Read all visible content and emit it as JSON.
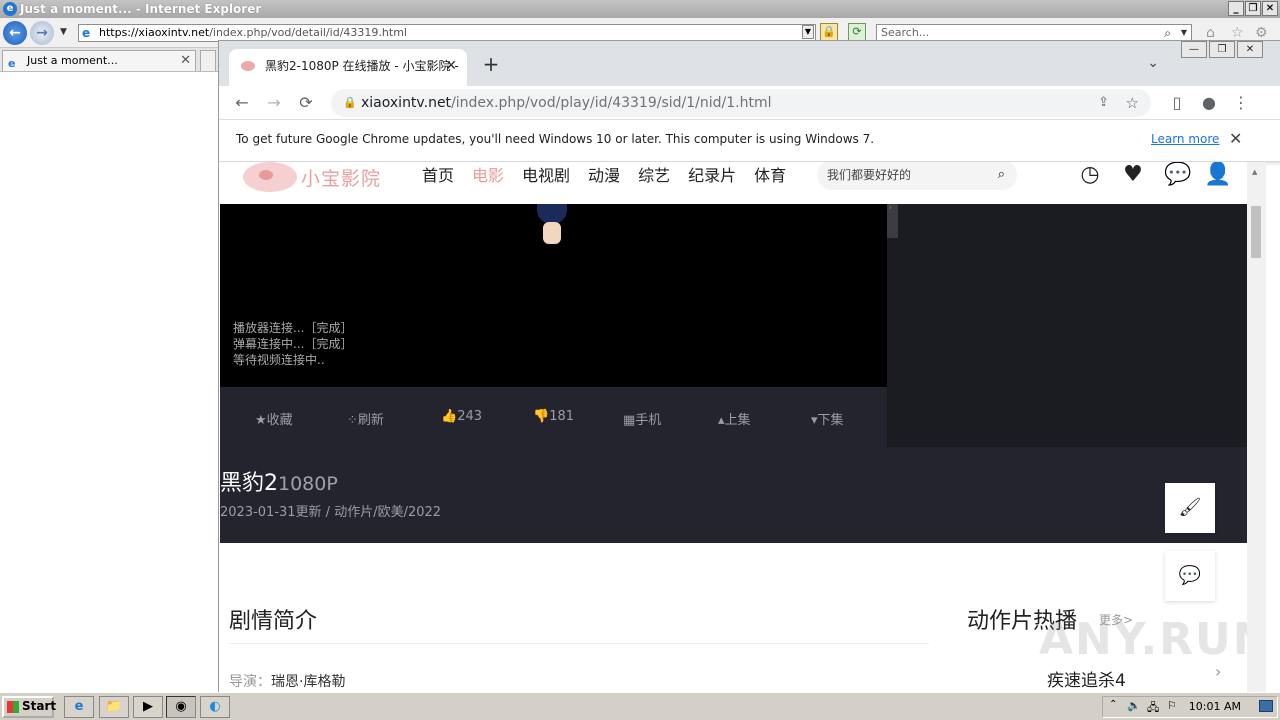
{
  "ie": {
    "title": "Just a moment... - Internet Explorer",
    "address_host": "https://xiaoxintv.net",
    "address_path": "/index.php/vod/detail/id/43319.html",
    "search_placeholder": "Search...",
    "tab_label": "Just a moment...",
    "back_glyph": "←",
    "forward_glyph": "→"
  },
  "chrome": {
    "tab_title": "黑豹2-1080P 在线播放 - 小宝影院 -",
    "omnibox_host": "xiaoxintv.net",
    "omnibox_path": "/index.php/vod/play/id/43319/sid/1/nid/1.html",
    "infobar_message": "To get future Google Chrome updates, you'll need Windows 10 or later. This computer is using Windows 7.",
    "infobar_link": "Learn more"
  },
  "site": {
    "logo_text": "小宝影院",
    "nav": [
      "首页",
      "电影",
      "电视剧",
      "动漫",
      "综艺",
      "纪录片",
      "体育"
    ],
    "nav_active_index": 1,
    "search_placeholder": "我们都要好好的",
    "player_log": [
      "播放器连接...［完成］",
      "弹幕连接中...［完成］",
      "等待视频连接中.."
    ],
    "controls": {
      "favorite": "收藏",
      "refresh": "刷新",
      "likes": "243",
      "dislikes": "181",
      "mobile": "手机",
      "prev": "上集",
      "next": "下集"
    },
    "movie_title": "黑豹2",
    "movie_quality": "1080P",
    "movie_meta": "2023-01-31更新 / 动作片/欧美/2022",
    "synopsis_heading": "剧情简介",
    "director_label": "导演：",
    "director_name": "瑞恩·库格勒",
    "hot_heading": "动作片热播",
    "hot_more": "更多>",
    "hot_item": "疾速追杀4"
  },
  "watermark": "ANY.RUN",
  "taskbar": {
    "start_label": "Start",
    "clock": "10:01 AM"
  }
}
